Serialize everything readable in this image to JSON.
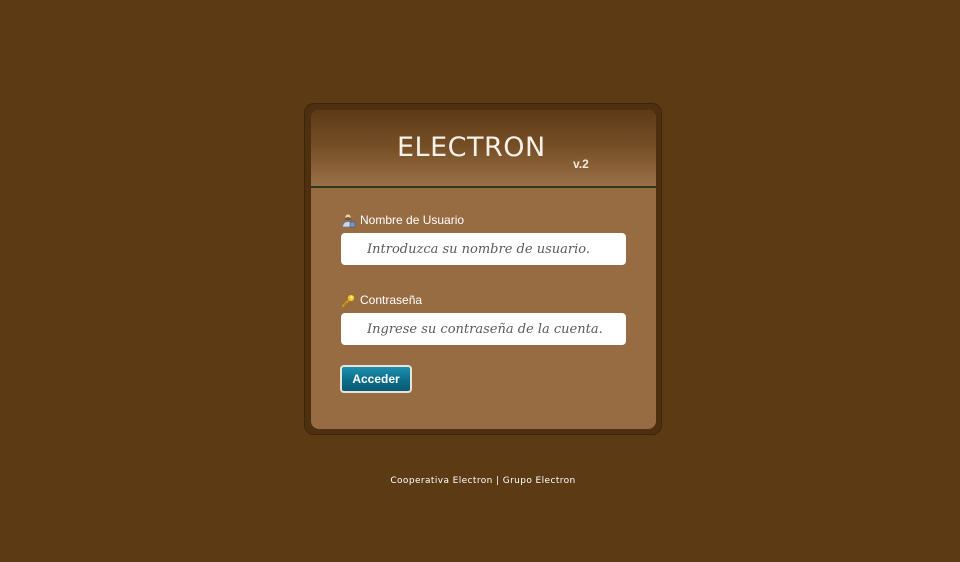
{
  "app": {
    "logo_text": "ELECTRON",
    "version": "v.2"
  },
  "login_form": {
    "username": {
      "label": "Nombre de Usuario",
      "placeholder": "Introduzca su nombre de usuario.",
      "value": "",
      "icon": "user-icon"
    },
    "password": {
      "label": "Contraseña",
      "placeholder": "Ingrese su contraseña de la cuenta.",
      "value": "",
      "icon": "key-icon"
    },
    "submit_label": "Acceder"
  },
  "footer": {
    "text": "Cooperativa Electron | Grupo Electron"
  },
  "colors": {
    "page_background": "#5c3a14",
    "panel_background": "#986c42",
    "button": "#0d6d8b"
  }
}
